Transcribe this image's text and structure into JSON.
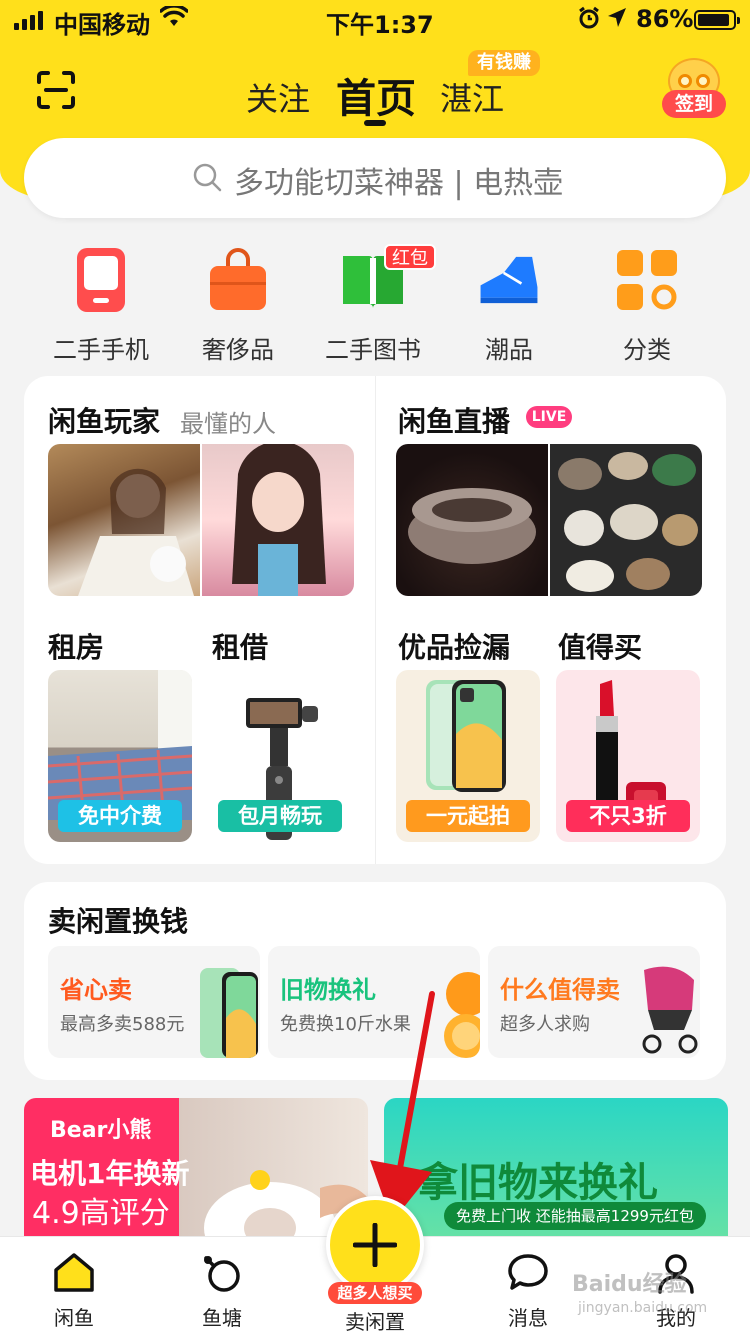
{
  "status_bar": {
    "carrier": "中国移动",
    "time": "下午1:37",
    "battery": "86%"
  },
  "header": {
    "tabs": [
      "关注",
      "首页",
      "湛江"
    ],
    "active_tab": "首页",
    "money_badge": "有钱赚",
    "sign_in": "签到"
  },
  "search": {
    "placeholder": "多功能切菜神器 | 电热壶"
  },
  "categories": [
    {
      "label": "二手手机",
      "icon": "phone-icon"
    },
    {
      "label": "奢侈品",
      "icon": "bag-icon"
    },
    {
      "label": "二手图书",
      "icon": "book-icon",
      "badge": "红包"
    },
    {
      "label": "潮品",
      "icon": "sneaker-icon"
    },
    {
      "label": "分类",
      "icon": "grid-icon"
    }
  ],
  "feature": {
    "players": {
      "title": "闲鱼玩家",
      "subtitle": "最懂的人"
    },
    "live": {
      "title": "闲鱼直播",
      "badge": "LIVE"
    },
    "rent": {
      "title": "租房",
      "pill": "免中介费"
    },
    "borrow": {
      "title": "租借",
      "pill": "包月畅玩"
    },
    "bargain": {
      "title": "优品捡漏",
      "pill": "一元起拍"
    },
    "worth": {
      "title": "值得买",
      "pill": "不只3折"
    }
  },
  "sell_section": {
    "title": "卖闲置换钱",
    "items": [
      {
        "title": "省心卖",
        "subtitle": "最高多卖588元",
        "color": "#ff5a1f"
      },
      {
        "title": "旧物换礼",
        "subtitle": "免费换10斤水果",
        "color": "#19c37d"
      },
      {
        "title": "什么值得卖",
        "subtitle": "超多人求购",
        "color": "#ff7a1f"
      }
    ]
  },
  "banners": {
    "left": {
      "brand": "Bear小熊",
      "line1": "电机1年换新",
      "line2": "4.9高评分"
    },
    "right": {
      "title": "拿旧物来换礼",
      "sub": "免费上门收 还能抽最高1299元红包"
    }
  },
  "tabbar": {
    "items": [
      "闲鱼",
      "鱼塘",
      "卖闲置",
      "消息",
      "我的"
    ],
    "fab_badge": "超多人想买"
  },
  "watermark": {
    "line1": "Baidu经验",
    "line2": "jingyan.baidu.com"
  }
}
